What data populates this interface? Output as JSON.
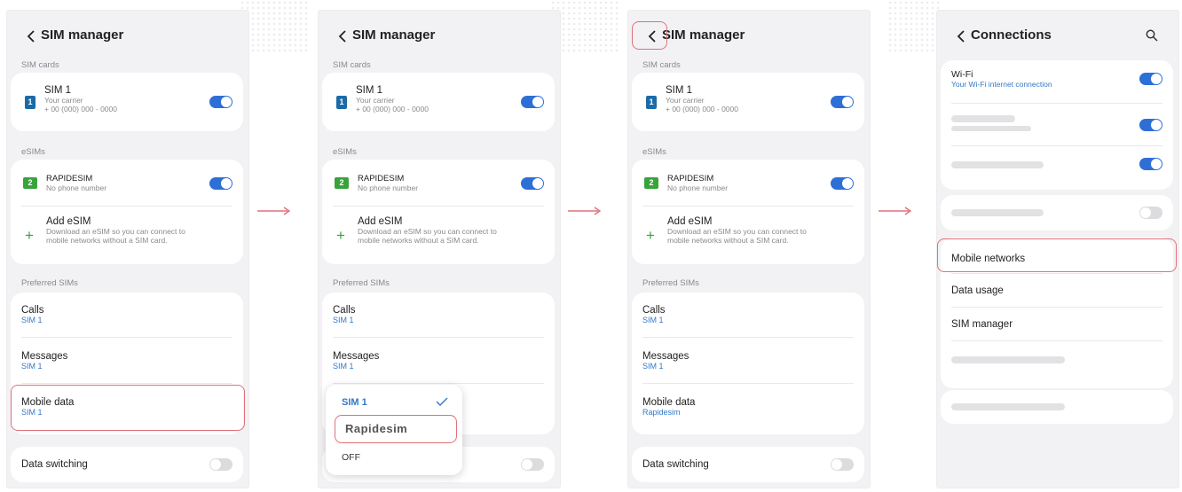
{
  "arrows": [
    "→",
    "→",
    "→"
  ],
  "sim": {
    "title": "SIM manager",
    "section_sim_cards": "SIM cards",
    "sim1_name": "SIM 1",
    "sim1_carrier": "Your carrier",
    "sim1_number": "+ 00 (000) 000 - 0000",
    "sim1_icon": "1",
    "section_esims": "eSIMs",
    "esim_name": "RAPIDESIM",
    "esim_sub": "No phone number",
    "esim_icon": "2",
    "add_esim_title": "Add eSIM",
    "add_esim_desc1": "Download an eSIM so you can connect to",
    "add_esim_desc2": "mobile networks without a SIM card.",
    "section_preferred": "Preferred SIMs",
    "calls_label": "Calls",
    "calls_value": "SIM 1",
    "messages_label": "Messages",
    "messages_value": "SIM 1",
    "mobile_data_label": "Mobile data",
    "mobile_data_value": "SIM 1",
    "mobile_data_value_updated": "Rapidesim",
    "data_switching_label": "Data switching"
  },
  "popup": {
    "option1": "SIM 1",
    "option2": "Rapidesim",
    "option3": "OFF",
    "check_icon": "check-icon"
  },
  "connections": {
    "title": "Connections",
    "wifi_label": "Wi-Fi",
    "wifi_sub": "Your Wi-Fi internet connection",
    "mobile_networks": "Mobile networks",
    "data_usage": "Data usage",
    "sim_manager": "SIM manager"
  },
  "colors": {
    "accent": "#2e6fd6",
    "highlight": "#e0707a",
    "sim_icon": "#1b6ba8",
    "esim_icon": "#39a33b"
  }
}
